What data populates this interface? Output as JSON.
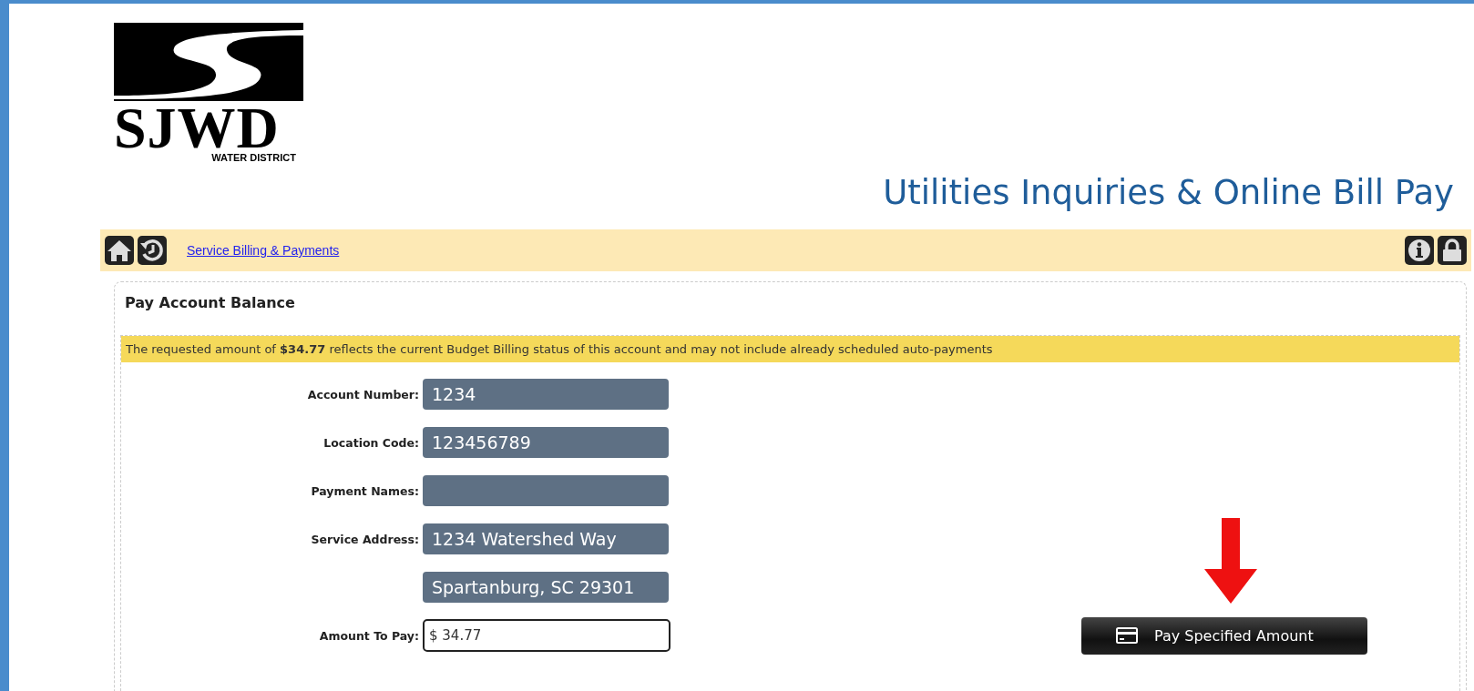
{
  "logo": {
    "letters": "SJWD",
    "subtitle": "WATER DISTRICT"
  },
  "header": {
    "title": "Utilities Inquiries & Online Bill Pay"
  },
  "nav": {
    "link": "Service Billing & Payments"
  },
  "panel": {
    "title": "Pay Account Balance",
    "notice": "The requested amount of **$34.77** reflects the current Budget Billing status of this account and may not include already scheduled auto-payments",
    "fields": [
      {
        "label": "Account Number:",
        "value": "1234"
      },
      {
        "label": "Location Code:",
        "value": "123456789"
      },
      {
        "label": "Payment Names:"
      },
      {
        "label": "Service Address:",
        "value": "1234 Watershed Way"
      },
      {
        "value": "Spartanburg, SC 29301"
      }
    ],
    "amount": {
      "label": "Amount To Pay:",
      "value": "$ 34.77"
    },
    "pay_button": "Pay Specified Amount"
  }
}
